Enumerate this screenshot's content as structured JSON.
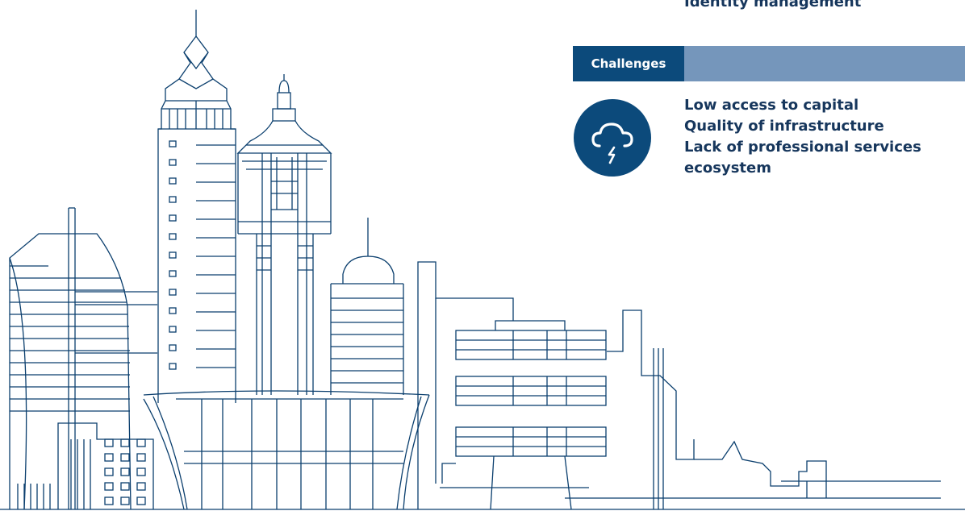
{
  "previous_item": "Identity management",
  "section": {
    "label": "Challenges",
    "icon": "cloud-lightning-icon",
    "items": [
      "Low access to capital",
      "Quality of infrastructure",
      "Lack of professional services",
      "ecosystem"
    ]
  },
  "colors": {
    "line_art": "#0b3f6e",
    "tab": "#0c4a7b",
    "bar": "#7596bb",
    "text": "#16365c"
  }
}
